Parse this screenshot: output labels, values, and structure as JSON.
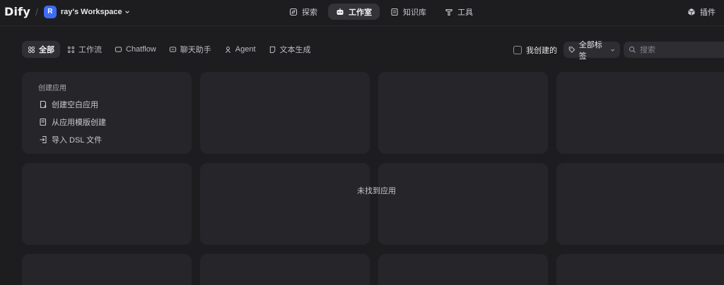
{
  "header": {
    "logo": "Dify",
    "workspace_initial": "R",
    "workspace_name": "ray's Workspace",
    "nav": [
      {
        "label": "探索",
        "icon": "explore-icon",
        "active": false
      },
      {
        "label": "工作室",
        "icon": "robot-icon",
        "active": true
      },
      {
        "label": "知识库",
        "icon": "book-icon",
        "active": false
      },
      {
        "label": "工具",
        "icon": "hammer-icon",
        "active": false
      }
    ],
    "plugins_label": "插件"
  },
  "filters": {
    "chips": [
      {
        "label": "全部",
        "icon": "grid-icon",
        "active": true
      },
      {
        "label": "工作流",
        "icon": "workflow-icon",
        "active": false
      },
      {
        "label": "Chatflow",
        "icon": "chatflow-icon",
        "active": false
      },
      {
        "label": "聊天助手",
        "icon": "chat-icon",
        "active": false
      },
      {
        "label": "Agent",
        "icon": "agent-icon",
        "active": false
      },
      {
        "label": "文本生成",
        "icon": "document-icon",
        "active": false
      }
    ],
    "created_by_me_label": "我创建的",
    "tags_label": "全部标签",
    "search_placeholder": "搜索"
  },
  "create": {
    "title": "创建应用",
    "options": [
      {
        "label": "创建空白应用",
        "icon": "blank-file-icon"
      },
      {
        "label": "从应用模版创建",
        "icon": "template-icon"
      },
      {
        "label": "导入 DSL 文件",
        "icon": "import-icon"
      }
    ]
  },
  "empty_state": "未找到应用",
  "colors": {
    "background": "#1d1d20",
    "card": "#26262a",
    "accent": "#3d6cf5"
  }
}
